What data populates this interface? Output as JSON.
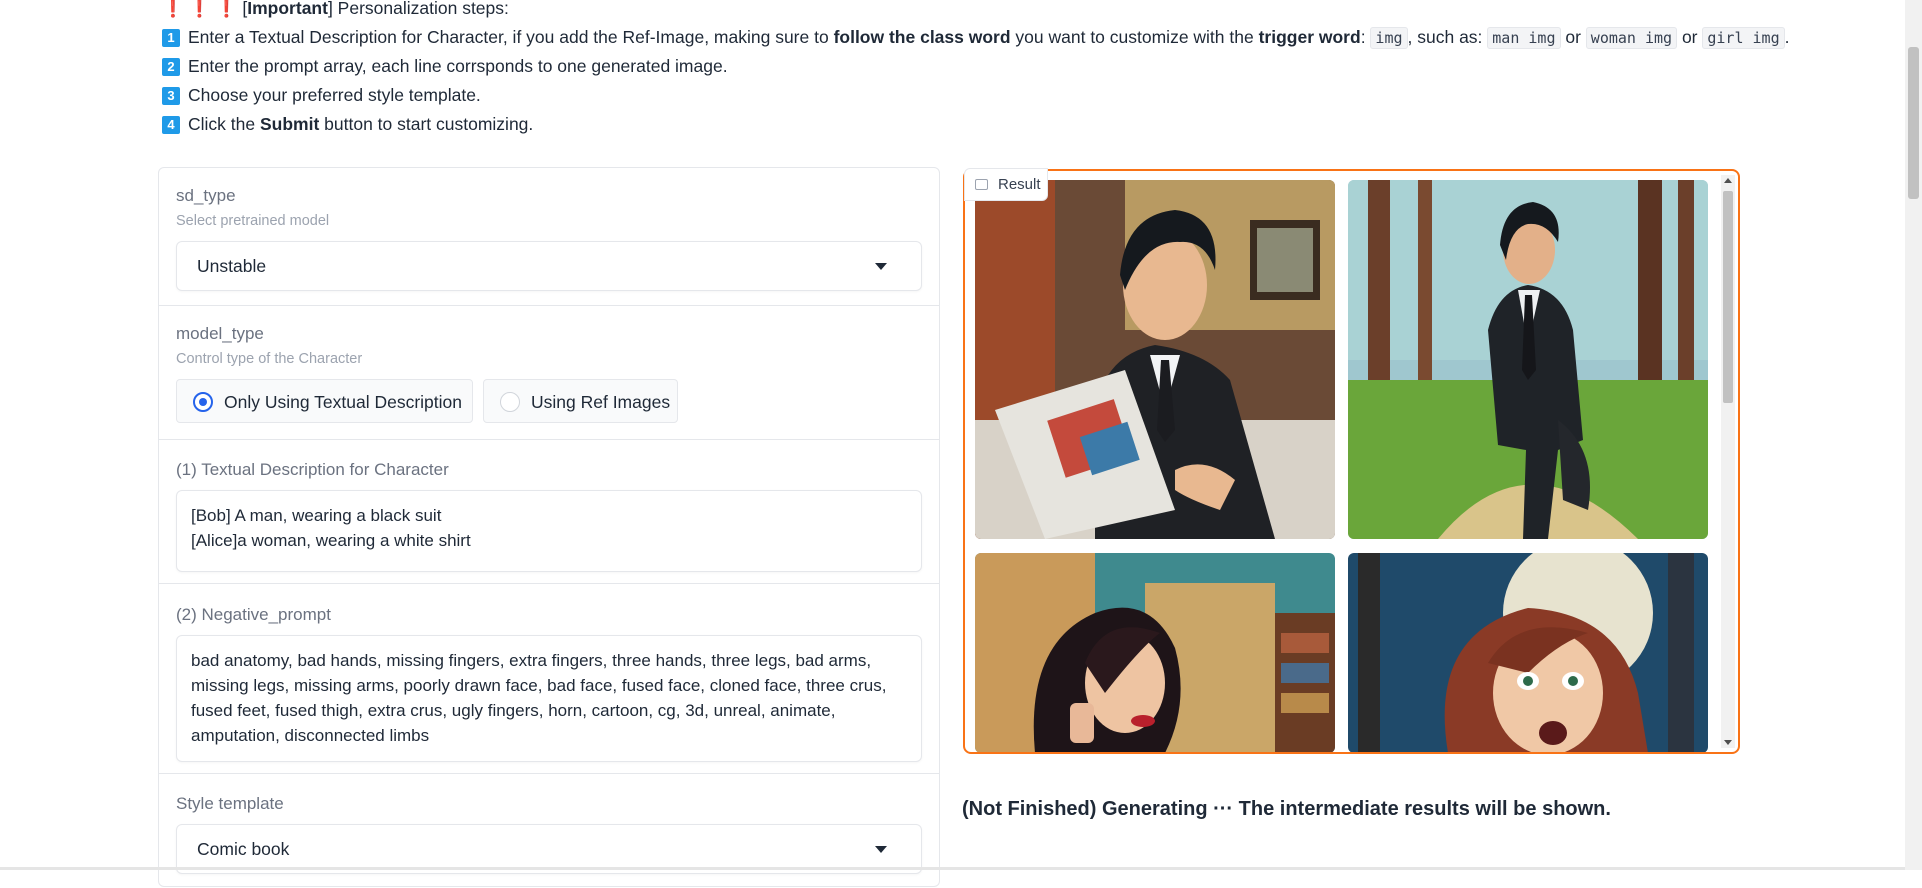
{
  "instructions": {
    "header_bangs": "❗❗❗",
    "header_open": "[",
    "header_bold": "Important",
    "header_close": "] Personalization steps:",
    "step1": {
      "num": "1",
      "t1": "Enter a Textual Description for Character, if you add the Ref-Image, making sure to ",
      "b1": "follow the class word",
      "t2": " you want to customize with the ",
      "b2": "trigger word",
      "t3": ": ",
      "c1": "img",
      "t4": ", such as: ",
      "c2": "man img",
      "t5": " or ",
      "c3": "woman img",
      "t6": " or ",
      "c4": "girl img",
      "t7": "."
    },
    "step2": {
      "num": "2",
      "text": "Enter the prompt array, each line corrsponds to one generated image."
    },
    "step3": {
      "num": "3",
      "text": "Choose your preferred style template."
    },
    "step4": {
      "num": "4",
      "t1": "Click the ",
      "b1": "Submit",
      "t2": " button to start customizing."
    }
  },
  "form": {
    "sd_type": {
      "label": "sd_type",
      "info": "Select pretrained model",
      "value": "Unstable"
    },
    "model_type": {
      "label": "model_type",
      "info": "Control type of the Character",
      "options": [
        "Only Using Textual Description",
        "Using Ref Images"
      ],
      "selected": "Only Using Textual Description"
    },
    "description": {
      "label": "(1) Textual Description for Character",
      "value": "[Bob] A man, wearing a black suit\n[Alice]a woman, wearing a white shirt"
    },
    "negative": {
      "label": "(2) Negative_prompt",
      "value": "bad anatomy, bad hands, missing fingers, extra fingers, three hands, three legs, bad arms, missing legs, missing arms, poorly drawn face, bad face, fused face, cloned face, three crus, fused feet, fused thigh, extra crus, ugly fingers, horn, cartoon, cg, 3d, unreal, animate, amputation, disconnected limbs"
    },
    "style": {
      "label": "Style template",
      "value": "Comic book"
    }
  },
  "result": {
    "tab_label": "Result",
    "images": [
      "comic-man-reading-newspaper",
      "comic-man-walking-forest",
      "comic-woman-on-phone",
      "comic-woman-frightened-forest"
    ]
  },
  "status": "(Not Finished) Generating ··· The intermediate results will be shown.",
  "colors": {
    "accent": "#f97316",
    "step_badge": "#1f9ae8",
    "radio": "#2563eb"
  }
}
